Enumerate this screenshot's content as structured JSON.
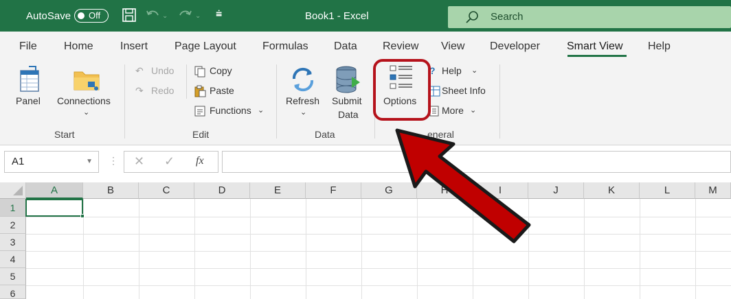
{
  "titlebar": {
    "autosave_label": "AutoSave",
    "autosave_state": "Off",
    "doc_title": "Book1  -  Excel",
    "search_placeholder": "Search"
  },
  "tabs": [
    {
      "label": "File"
    },
    {
      "label": "Home"
    },
    {
      "label": "Insert"
    },
    {
      "label": "Page Layout"
    },
    {
      "label": "Formulas"
    },
    {
      "label": "Data"
    },
    {
      "label": "Review"
    },
    {
      "label": "View"
    },
    {
      "label": "Developer"
    },
    {
      "label": "Smart View",
      "active": true
    },
    {
      "label": "Help"
    }
  ],
  "ribbon": {
    "start": {
      "group_label": "Start",
      "panel": "Panel",
      "connections": "Connections"
    },
    "edit": {
      "group_label": "Edit",
      "undo": "Undo",
      "redo": "Redo",
      "copy": "Copy",
      "paste": "Paste",
      "functions": "Functions"
    },
    "data": {
      "group_label": "Data",
      "refresh": "Refresh",
      "submit_line1": "Submit",
      "submit_line2": "Data"
    },
    "general": {
      "group_label": "eneral",
      "options": "Options",
      "help": "Help",
      "sheet_info": "Sheet Info",
      "more": "More"
    }
  },
  "formula_bar": {
    "name_box": "A1",
    "fx": "fx",
    "value": ""
  },
  "grid": {
    "columns": [
      "A",
      "B",
      "C",
      "D",
      "E",
      "F",
      "G",
      "H",
      "I",
      "J",
      "K",
      "L",
      "M"
    ],
    "rows": [
      "1",
      "2",
      "3",
      "4",
      "5",
      "6"
    ],
    "active_cell": "A1"
  },
  "colors": {
    "excel_green": "#217346",
    "highlight_red": "#b5121b"
  }
}
